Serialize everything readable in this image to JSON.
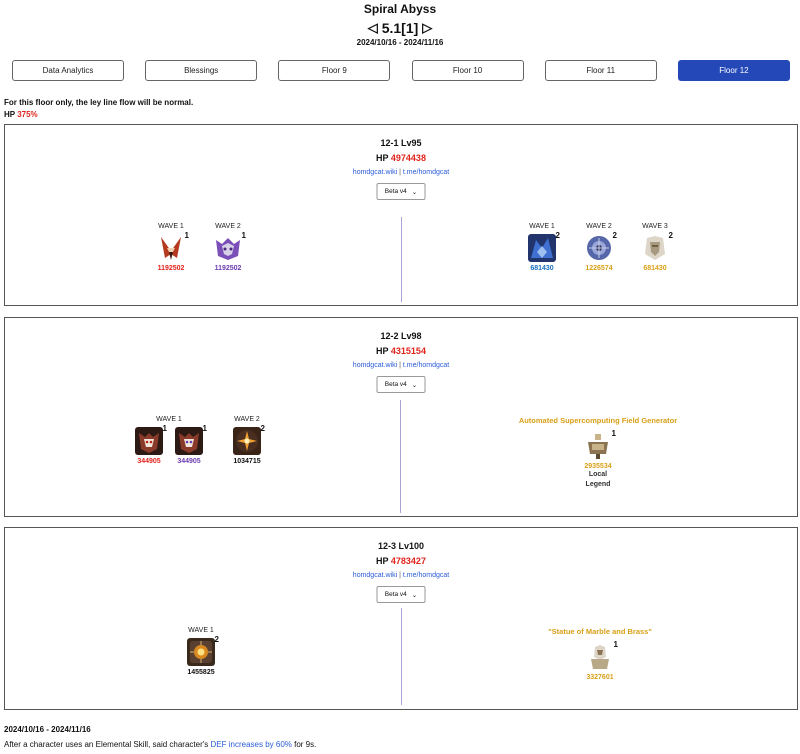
{
  "header": {
    "title": "Spiral Abyss",
    "prev": "◁",
    "version": "5.1[1]",
    "next": "▷",
    "dates": "2024/10/16 - 2024/11/16"
  },
  "tabs": [
    "Data Analytics",
    "Blessings",
    "Floor 9",
    "Floor 10",
    "Floor 11",
    "Floor 12"
  ],
  "active_tab": "Floor 12",
  "floor_note": {
    "text": "For this floor only, the ley line flow will be normal.",
    "hp_label": "HP",
    "hp_value": "375%"
  },
  "chambers": [
    {
      "title": "12-1 Lv95",
      "hp_label": "HP",
      "hp_value": "4974438",
      "link1": "homdgcat.wiki",
      "sep": "|",
      "link2": "t.me/homdgcat",
      "select": "Beta v4",
      "left": [
        {
          "label": "WAVE 1",
          "enemies": [
            {
              "icon": "red-hound-icon",
              "count": "1",
              "hp": "1192502",
              "hp_color": "red"
            }
          ]
        },
        {
          "label": "WAVE 2",
          "enemies": [
            {
              "icon": "purple-mask-icon",
              "count": "1",
              "hp": "1192502",
              "hp_color": "purple"
            }
          ]
        }
      ],
      "right": [
        {
          "label": "WAVE 1",
          "enemies": [
            {
              "icon": "blue-dragon-icon",
              "count": "2",
              "hp": "681430",
              "hp_color": "blue"
            }
          ]
        },
        {
          "label": "WAVE 2",
          "enemies": [
            {
              "icon": "blue-sphere-icon",
              "count": "2",
              "hp": "1226574",
              "hp_color": "gold"
            }
          ]
        },
        {
          "label": "WAVE 3",
          "enemies": [
            {
              "icon": "white-knight-icon",
              "count": "2",
              "hp": "681430",
              "hp_color": "gold"
            }
          ]
        }
      ]
    },
    {
      "title": "12-2 Lv98",
      "hp_label": "HP",
      "hp_value": "4315154",
      "link1": "homdgcat.wiki",
      "sep": "|",
      "link2": "t.me/homdgcat",
      "select": "Beta v4",
      "left": [
        {
          "label": "WAVE 1",
          "enemies": [
            {
              "icon": "red-beast-icon",
              "count": "1",
              "hp": "344905",
              "hp_color": "red"
            },
            {
              "icon": "purple-beast-icon",
              "count": "1",
              "hp": "344905",
              "hp_color": "purple"
            }
          ]
        },
        {
          "label": "WAVE 2",
          "enemies": [
            {
              "icon": "orange-cross-icon",
              "count": "2",
              "hp": "1034715",
              "hp_color": "black"
            }
          ]
        }
      ],
      "right_boss": {
        "name": "Automated Supercomputing Field Generator",
        "icon": "field-generator-icon",
        "count": "1",
        "hp": "2935534",
        "sub1": "Local",
        "sub2": "Legend"
      }
    },
    {
      "title": "12-3 Lv100",
      "hp_label": "HP",
      "hp_value": "4783427",
      "link1": "homdgcat.wiki",
      "sep": "|",
      "link2": "t.me/homdgcat",
      "select": "Beta v4",
      "left": [
        {
          "label": "WAVE 1",
          "enemies": [
            {
              "icon": "fire-core-icon",
              "count": "2",
              "hp": "1455825",
              "hp_color": "black"
            }
          ]
        }
      ],
      "right_boss": {
        "name": "\"Statue of Marble and Brass\"",
        "icon": "marble-statue-icon",
        "count": "1",
        "hp": "3327601"
      }
    }
  ],
  "footer": {
    "date": "2024/10/16 - 2024/11/16",
    "text_a": "After a character uses an Elemental Skill, said character's ",
    "text_b": "DEF increases by 60%",
    "text_c": " for 9s."
  },
  "colors": {
    "accent": "#2448b8",
    "red": "#e0241c",
    "purple": "#6d3cb0",
    "blue": "#1a6fbd",
    "gold": "#d9a019",
    "link": "#2a5bd7"
  }
}
